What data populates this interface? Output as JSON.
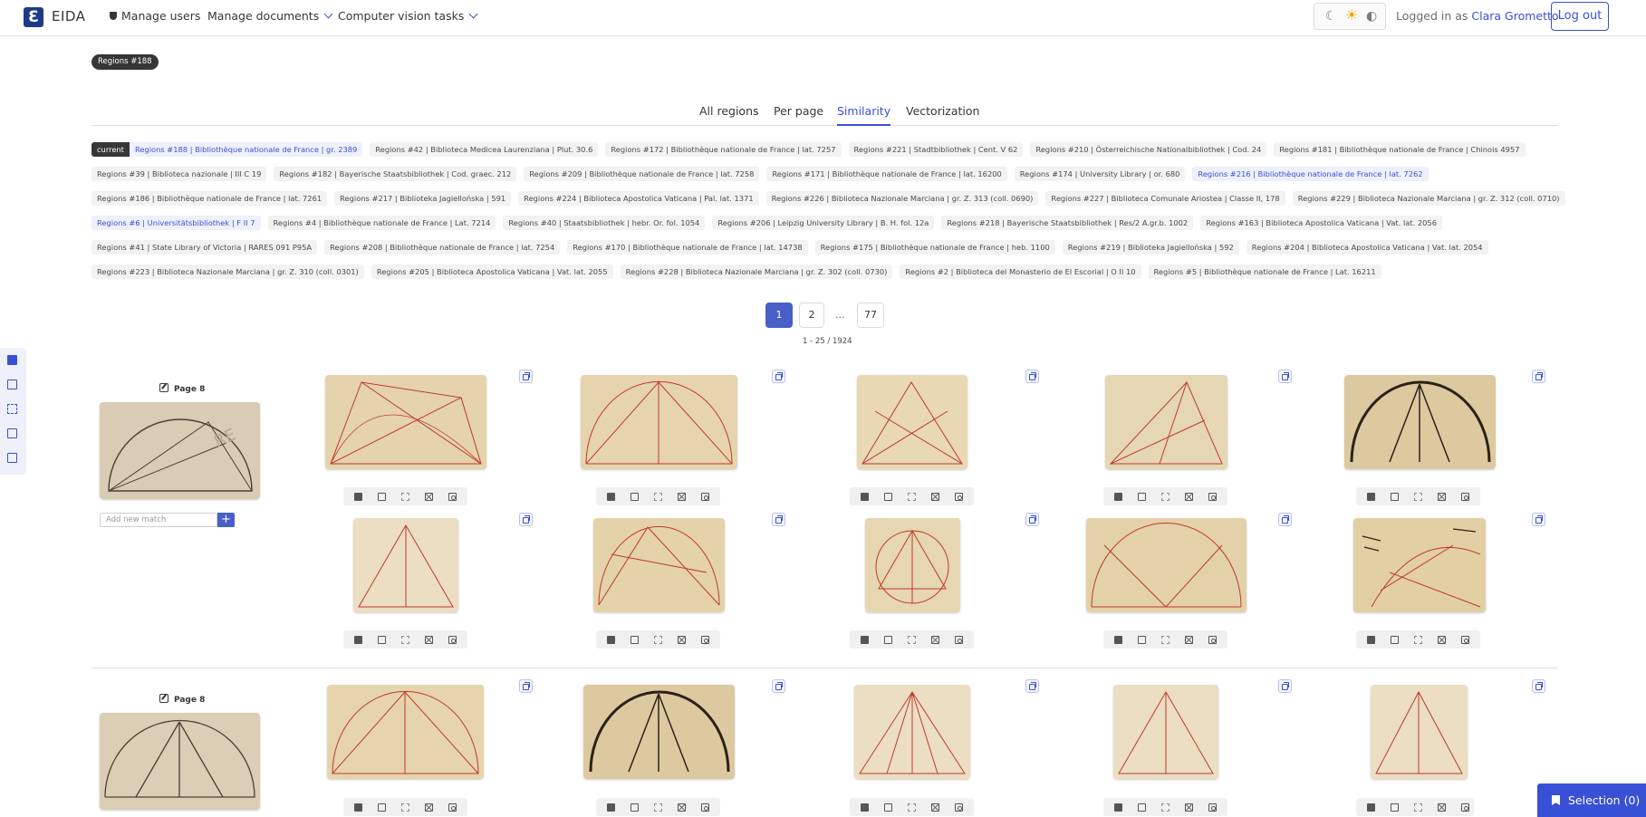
{
  "nav": {
    "brand": "EIDA",
    "logo_glyph": "Ɛ",
    "manage_users": "Manage users",
    "manage_documents": "Manage documents",
    "cv_tasks": "Computer vision tasks",
    "logged_prefix": "Logged in as",
    "user_name": "Clara Grometto",
    "logout": "Log out"
  },
  "theme": {
    "moon": "☾",
    "sun": "☀",
    "contrast": "◐"
  },
  "region_tag": "Regions #188",
  "tabs": [
    "All regions",
    "Per page",
    "Similarity",
    "Vectorization"
  ],
  "active_tab": "Similarity",
  "current_label": "current",
  "chips": [
    [
      "Regions #188 | Bibliothèque nationale de France | gr. 2389",
      "Regions #42 | Biblioteca Medicea Laurenziana | Plut. 30.6",
      "Regions #172 | Bibliothèque nationale de France | lat. 7257",
      "Regions #221 | Stadtbibliothek | Cent. V 62",
      "Regions #210 | Österreichische Nationalbibliothek | Cod. 24",
      "Regions #181 | Bibliothèque nationale de France | Chinois 4957"
    ],
    [
      "Regions #39 | Biblioteca nazionale | III C 19",
      "Regions #182 | Bayerische Staatsbibliothek | Cod. graec. 212",
      "Regions #209 | Bibliothèque nationale de France | lat. 7258",
      "Regions #171 | Bibliothèque nationale de France | lat. 16200",
      "Regions #174 | University Library | or. 680",
      "Regions #216 | Bibliothèque nationale de France | lat. 7262"
    ],
    [
      "Regions #186 | Bibliothèque nationale de France | lat. 7261",
      "Regions #217 | Biblioteka Jagiellońska | 591",
      "Regions #224 | Biblioteca Apostolica Vaticana | Pal. lat. 1371",
      "Regions #226 | Biblioteca Nazionale Marciana | gr. Z. 313 (coll. 0690)",
      "Regions #227 | Biblioteca Comunale Ariostea | Classe II, 178",
      "Regions #229 | Biblioteca Nazionale Marciana | gr. Z. 312 (coll. 0710)"
    ],
    [
      "Regions #6 | Universitätsbibliothek | F II 7",
      "Regions #4 | Bibliothèque nationale de France | Lat. 7214",
      "Regions #40 | Staatsbibliothek | hebr. Or. fol. 1054",
      "Regions #206 | Leipzig University Library | B. H. fol. 12a",
      "Regions #218 | Bayerische Staatsbibliothek | Res/2 A.gr.b. 1002",
      "Regions #163 | Biblioteca Apostolica Vaticana | Vat. lat. 2056"
    ],
    [
      "Regions #41 | State Library of Victoria | RARES 091 P95A",
      "Regions #208 | Bibliothèque nationale de France | lat. 7254",
      "Regions #170 | Bibliothèque nationale de France | lat. 14738",
      "Regions #175 | Bibliothèque nationale de France | heb. 1100",
      "Regions #219 | Biblioteka Jagiellońska | 592",
      "Regions #204 | Biblioteca Apostolica Vaticana | Vat. lat. 2054"
    ],
    [
      "Regions #223 | Biblioteca Nazionale Marciana | gr. Z. 310 (coll. 0301)",
      "Regions #205 | Biblioteca Apostolica Vaticana | Vat. lat. 2055",
      "Regions #228 | Biblioteca Nazionale Marciana | gr. Z. 302 (coll. 0730)",
      "Regions #2 | Biblioteca del Monasterio de El Escorial | O II 10",
      "Regions #5 | Bibliothèque nationale de France | Lat. 16211"
    ]
  ],
  "selected_chips": [
    "Regions #188 | Bibliothèque nationale de France | gr. 2389",
    "Regions #216 | Bibliothèque nationale de France | lat. 7262",
    "Regions #6 | Universitätsbibliothek | F II 7"
  ],
  "pagination": {
    "pages": [
      "1",
      "2",
      "77"
    ],
    "ellipsis": "...",
    "current": "1",
    "range": "1 - 25 / 1924"
  },
  "query_blocks": [
    {
      "page_label": "Page 8",
      "add_placeholder": "Add new match",
      "add_label": "+"
    },
    {
      "page_label": "Page 8"
    }
  ],
  "selection_button": "Selection (0)",
  "colors": {
    "accent": "#3850d6",
    "parchment": "#e6d6b0",
    "red_ink": "#c0392b",
    "dark_ink": "#2b2118"
  }
}
